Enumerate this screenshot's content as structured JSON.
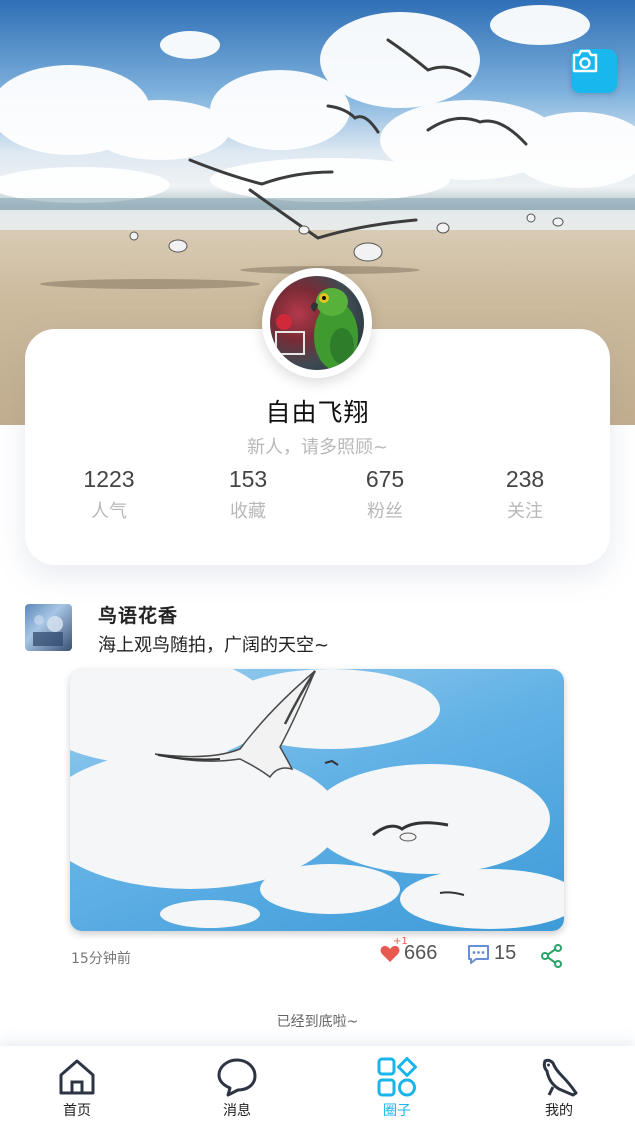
{
  "cover": {
    "camera_icon": "camera-icon",
    "accent": "#18b7ee"
  },
  "profile": {
    "name": "自由飞翔",
    "bio": "新人，请多照顾~",
    "stats": [
      {
        "value": "1223",
        "label": "人气"
      },
      {
        "value": "153",
        "label": "收藏"
      },
      {
        "value": "675",
        "label": "粉丝"
      },
      {
        "value": "238",
        "label": "关注"
      }
    ]
  },
  "post": {
    "author": "鸟语花香",
    "text": "海上观鸟随拍，广阔的天空~",
    "time": "15分钟前",
    "like_badge": "+1",
    "likes": "666",
    "comments": "15",
    "like_icon": "heart-icon",
    "comment_icon": "comment-icon",
    "share_icon": "share-icon",
    "like_color": "#e85a4f",
    "comment_color": "#6a8fd8",
    "share_color": "#2aa36b"
  },
  "footer": {
    "end_text": "已经到底啦~"
  },
  "tabbar": {
    "items": [
      {
        "label": "首页",
        "icon": "home-icon",
        "active": false
      },
      {
        "label": "消息",
        "icon": "chat-bubble-icon",
        "active": false
      },
      {
        "label": "圈子",
        "icon": "circle-grid-icon",
        "active": true
      },
      {
        "label": "我的",
        "icon": "bird-icon",
        "active": false
      }
    ],
    "active_color": "#19b4ea"
  }
}
